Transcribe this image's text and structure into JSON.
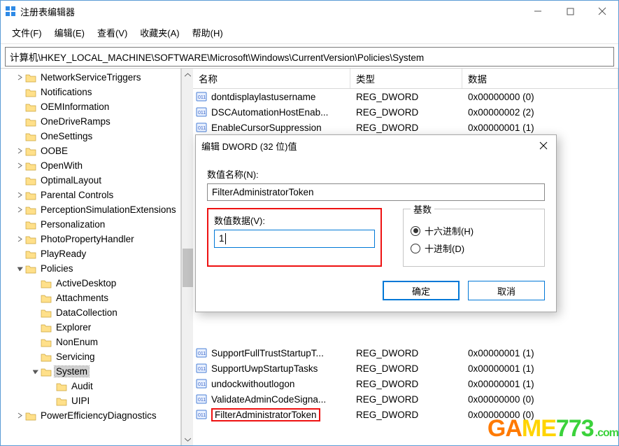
{
  "window": {
    "title": "注册表编辑器"
  },
  "menu": {
    "file": "文件(F)",
    "edit": "编辑(E)",
    "view": "查看(V)",
    "fav": "收藏夹(A)",
    "help": "帮助(H)"
  },
  "path": "计算机\\HKEY_LOCAL_MACHINE\\SOFTWARE\\Microsoft\\Windows\\CurrentVersion\\Policies\\System",
  "tree": [
    {
      "indent": 0,
      "exp": "closed",
      "label": "NetworkServiceTriggers"
    },
    {
      "indent": 0,
      "exp": "none",
      "label": "Notifications"
    },
    {
      "indent": 0,
      "exp": "none",
      "label": "OEMInformation"
    },
    {
      "indent": 0,
      "exp": "none",
      "label": "OneDriveRamps"
    },
    {
      "indent": 0,
      "exp": "none",
      "label": "OneSettings"
    },
    {
      "indent": 0,
      "exp": "closed",
      "label": "OOBE"
    },
    {
      "indent": 0,
      "exp": "closed",
      "label": "OpenWith"
    },
    {
      "indent": 0,
      "exp": "none",
      "label": "OptimalLayout"
    },
    {
      "indent": 0,
      "exp": "closed",
      "label": "Parental Controls"
    },
    {
      "indent": 0,
      "exp": "closed",
      "label": "PerceptionSimulationExtensions"
    },
    {
      "indent": 0,
      "exp": "none",
      "label": "Personalization"
    },
    {
      "indent": 0,
      "exp": "closed",
      "label": "PhotoPropertyHandler"
    },
    {
      "indent": 0,
      "exp": "none",
      "label": "PlayReady"
    },
    {
      "indent": 0,
      "exp": "open",
      "label": "Policies"
    },
    {
      "indent": 1,
      "exp": "none",
      "label": "ActiveDesktop"
    },
    {
      "indent": 1,
      "exp": "none",
      "label": "Attachments"
    },
    {
      "indent": 1,
      "exp": "none",
      "label": "DataCollection"
    },
    {
      "indent": 1,
      "exp": "none",
      "label": "Explorer"
    },
    {
      "indent": 1,
      "exp": "none",
      "label": "NonEnum"
    },
    {
      "indent": 1,
      "exp": "none",
      "label": "Servicing"
    },
    {
      "indent": 1,
      "exp": "open",
      "label": "System",
      "selected": true
    },
    {
      "indent": 2,
      "exp": "none",
      "label": "Audit"
    },
    {
      "indent": 2,
      "exp": "none",
      "label": "UIPI"
    },
    {
      "indent": 0,
      "exp": "closed",
      "label": "PowerEfficiencyDiagnostics"
    }
  ],
  "columns": {
    "name": "名称",
    "type": "类型",
    "data": "数据"
  },
  "values_top": [
    {
      "name": "dontdisplaylastusername",
      "type": "REG_DWORD",
      "data": "0x00000000 (0)"
    },
    {
      "name": "DSCAutomationHostEnab...",
      "type": "REG_DWORD",
      "data": "0x00000002 (2)"
    },
    {
      "name": "EnableCursorSuppression",
      "type": "REG_DWORD",
      "data": "0x00000001 (1)"
    }
  ],
  "values_bottom": [
    {
      "name": "SupportFullTrustStartupT...",
      "type": "REG_DWORD",
      "data": "0x00000001 (1)"
    },
    {
      "name": "SupportUwpStartupTasks",
      "type": "REG_DWORD",
      "data": "0x00000001 (1)"
    },
    {
      "name": "undockwithoutlogon",
      "type": "REG_DWORD",
      "data": "0x00000001 (1)"
    },
    {
      "name": "ValidateAdminCodeSigna...",
      "type": "REG_DWORD",
      "data": "0x00000000 (0)"
    },
    {
      "name": "FilterAdministratorToken",
      "type": "REG_DWORD",
      "data": "0x00000000 (0)",
      "highlighted": true
    }
  ],
  "dialog": {
    "title": "编辑 DWORD (32 位)值",
    "name_label": "数值名称(N):",
    "name_value": "FilterAdministratorToken",
    "value_label": "数值数据(V):",
    "value_data": "1",
    "base_label": "基数",
    "radio_hex": "十六进制(H)",
    "radio_dec": "十进制(D)",
    "ok": "确定",
    "cancel": "取消"
  },
  "watermark": {
    "text": "GAME773",
    "suffix": ".com"
  }
}
